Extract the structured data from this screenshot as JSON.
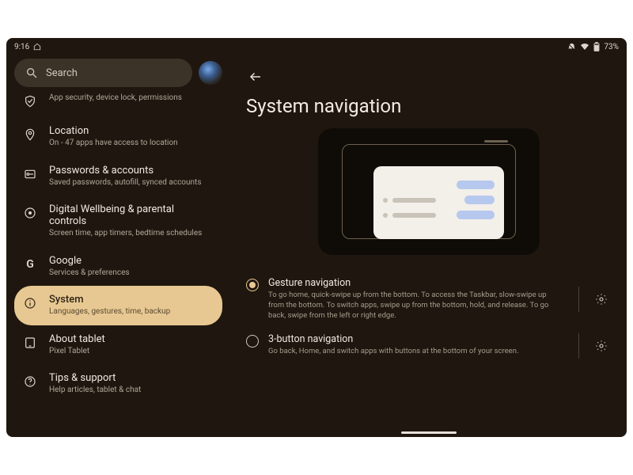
{
  "statusbar": {
    "time": "9:16",
    "battery": "73%"
  },
  "search": {
    "placeholder": "Search"
  },
  "sidebar": {
    "items": [
      {
        "title": "",
        "sub": "App security, device lock, permissions",
        "icon": "shield"
      },
      {
        "title": "Location",
        "sub": "On - 47 apps have access to location",
        "icon": "pin"
      },
      {
        "title": "Passwords & accounts",
        "sub": "Saved passwords, autofill, synced accounts",
        "icon": "key"
      },
      {
        "title": "Digital Wellbeing & parental controls",
        "sub": "Screen time, app timers, bedtime schedules",
        "icon": "wellbeing"
      },
      {
        "title": "Google",
        "sub": "Services & preferences",
        "icon": "google"
      },
      {
        "title": "System",
        "sub": "Languages, gestures, time, backup",
        "icon": "info"
      },
      {
        "title": "About tablet",
        "sub": "Pixel Tablet",
        "icon": "tablet"
      },
      {
        "title": "Tips & support",
        "sub": "Help articles, tablet & chat",
        "icon": "help"
      }
    ],
    "active_index": 5
  },
  "page": {
    "title": "System navigation",
    "options": [
      {
        "title": "Gesture navigation",
        "desc": "To go home, quick-swipe up from the bottom. To access the Taskbar, slow-swipe up from the bottom. To switch apps, swipe up from the bottom, hold, and release. To go back, swipe from the left or right edge.",
        "selected": true
      },
      {
        "title": "3-button navigation",
        "desc": "Go back, Home, and switch apps with buttons at the bottom of your screen.",
        "selected": false
      }
    ]
  }
}
